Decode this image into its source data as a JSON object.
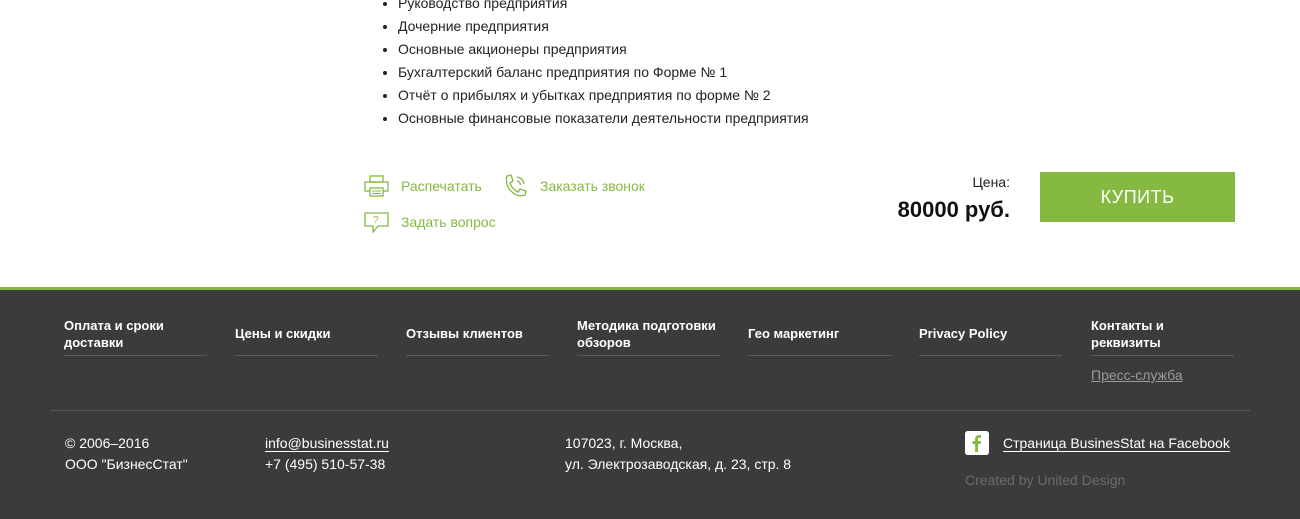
{
  "features": [
    "Руководство предприятия",
    "Дочерние предприятия",
    "Основные акционеры предприятия",
    "Бухгалтерский баланс предприятия по Форме № 1",
    "Отчёт о прибылях и убытках предприятия по форме № 2",
    "Основные финансовые показатели деятельности предприятия"
  ],
  "actions": {
    "print": "Распечатать",
    "callback": "Заказать звонок",
    "question": "Задать вопрос"
  },
  "price": {
    "label": "Цена:",
    "value": "80000 руб."
  },
  "buy_label": "КУПИТЬ",
  "footer_nav": [
    "Оплата и сроки доставки",
    "Цены и скидки",
    "Отзывы клиентов",
    "Методика подготовки обзоров",
    "Гео маркетинг",
    "Privacy Policy",
    "Контакты и реквизиты"
  ],
  "press_link": "Пресс-служба",
  "copyright": {
    "years": "© 2006–2016",
    "company": "ООО \"БизнесСтат\""
  },
  "contacts": {
    "email": "info@businesstat.ru",
    "phone": "+7 (495) 510-57-38"
  },
  "address": {
    "line1": "107023, г. Москва,",
    "line2": "ул. Электрозаводская, д. 23, стр. 8"
  },
  "facebook_link": "Страница BusinesStat на Facebook",
  "created_by": "Created by United Design",
  "colors": {
    "accent": "#85b941",
    "footer_bg": "#3b3b3b"
  }
}
